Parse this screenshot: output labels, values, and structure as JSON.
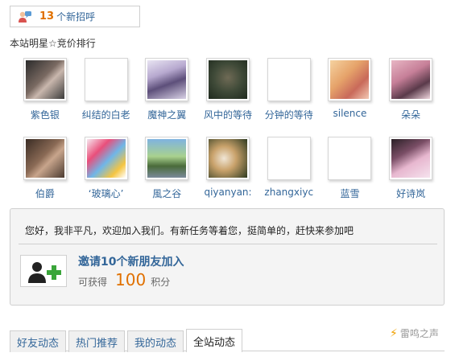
{
  "greeting": {
    "count": "13",
    "text": "个新招呼"
  },
  "stars": {
    "title": "本站明星☆竞价排行",
    "row1": [
      {
        "name": "紫色银",
        "avatar": "photo"
      },
      {
        "name": "纠结的白老",
        "avatar": "blank"
      },
      {
        "name": "魔神之翼",
        "avatar": "photo"
      },
      {
        "name": "风中的等待",
        "avatar": "photo"
      },
      {
        "name": "分钟的等待",
        "avatar": "blank"
      },
      {
        "name": "silence",
        "avatar": "photo"
      },
      {
        "name": "朵朵",
        "avatar": "photo"
      }
    ],
    "row2": [
      {
        "name": "伯爵",
        "avatar": "photo"
      },
      {
        "name": "‘玻璃心’",
        "avatar": "photo"
      },
      {
        "name": "風之谷",
        "avatar": "photo"
      },
      {
        "name": "qiyanyan:",
        "avatar": "photo"
      },
      {
        "name": "zhangxiyc",
        "avatar": "blank"
      },
      {
        "name": "蓝雪",
        "avatar": "blank"
      },
      {
        "name": "好诗岚",
        "avatar": "photo"
      }
    ]
  },
  "invite": {
    "message": "您好，我非平凡，欢迎加入我们。有新任务等着您，挺简单的，赶快来参加吧",
    "title": "邀请10个新朋友加入",
    "points_prefix": "可获得",
    "points_value": "100",
    "points_unit": "积分"
  },
  "tabs": [
    "好友动态",
    "热门推荐",
    "我的动态",
    "全站动态"
  ],
  "active_tab": "全站动态",
  "brand": "雷鸣之声",
  "colors": {
    "link": "#336699",
    "accent": "#e07000"
  }
}
